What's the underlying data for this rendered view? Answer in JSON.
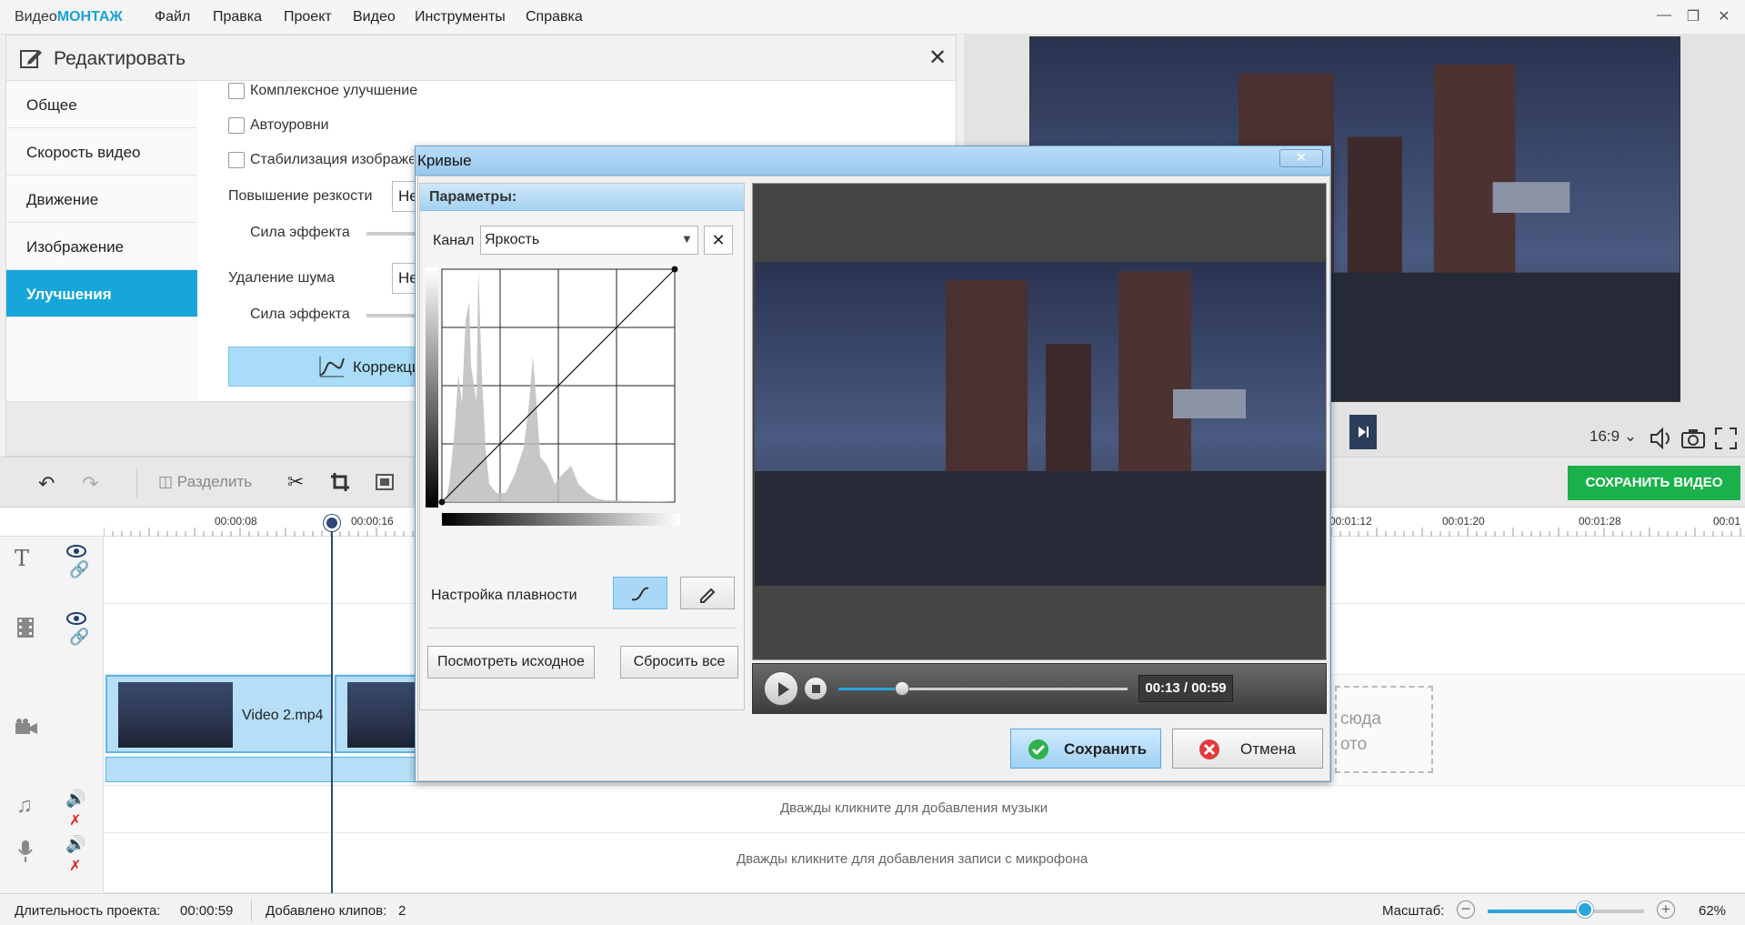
{
  "app": {
    "logo_prefix": "Видео",
    "logo_suffix": "МОНТАЖ",
    "menu": [
      "Файл",
      "Правка",
      "Проект",
      "Видео",
      "Инструменты",
      "Справка"
    ]
  },
  "edit_panel": {
    "title": "Редактировать",
    "nav": [
      "Общее",
      "Скорость видео",
      "Движение",
      "Изображение",
      "Улучшения"
    ],
    "active_nav": "Улучшения",
    "checkboxes": [
      "Комплексное улучшение",
      "Автоуровни",
      "Стабилизация изображения"
    ],
    "sharpen_label": "Повышение резкости",
    "sharpen_value": "Не",
    "strength_label_1": "Сила эффекта",
    "denoise_label": "Удаление шума",
    "denoise_value": "Не",
    "strength_label_2": "Сила эффекта",
    "correction_button": "Коррекция"
  },
  "preview": {
    "ratio": "16:9"
  },
  "toolbar": {
    "split_label": "Разделить",
    "save_video": "СОХРАНИТЬ ВИДЕО"
  },
  "timeline": {
    "ticks": [
      "00:00:08",
      "00:00:16",
      "00:01:12",
      "00:01:20",
      "00:01:28",
      "00:01"
    ],
    "clip1_name": "Video 2.mp4",
    "drop_hint_line1": "сюда",
    "drop_hint_line2": "ото",
    "music_hint": "Дважды кликните для добавления музыки",
    "mic_hint": "Дважды кликните для добавления записи с микрофона"
  },
  "status": {
    "duration_label": "Длительность проекта:",
    "duration_value": "00:00:59",
    "clips_label": "Добавлено клипов:",
    "clips_value": "2",
    "zoom_label": "Масштаб:",
    "zoom_value": "62%",
    "zoom_level": 0.62
  },
  "curves_dialog": {
    "title": "Кривые",
    "params_header": "Параметры:",
    "channel_label": "Канал",
    "channel_value": "Яркость",
    "smoothness_label": "Настройка плавности",
    "view_original": "Посмотреть исходное",
    "reset_all": "Сбросить все",
    "time": "00:13 / 00:59",
    "progress": 0.22,
    "save": "Сохранить",
    "cancel": "Отмена"
  }
}
